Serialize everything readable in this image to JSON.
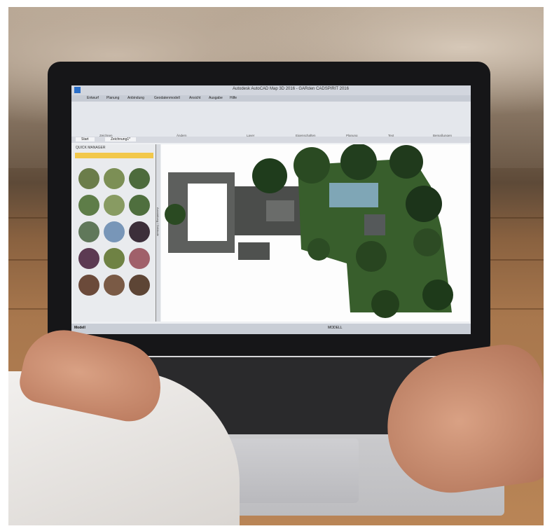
{
  "screen": {
    "title_bar": "Autodesk AutoCAD Map 3D 2016 - GARden CADSPIRIT 2016",
    "ribbon_tabs": [
      "Entwurf",
      "Planung",
      "Anbindung",
      "Geodatenmodell",
      "Ansicht",
      "Ausgabe",
      "Hilfe"
    ],
    "ribbon_groups": [
      "Zeichnen",
      "Ändern",
      "Layer",
      "Eigenschaften",
      "Planung",
      "Text",
      "Bemaßungen"
    ],
    "doc_tabs": [
      "Start",
      "Zeichnung1*"
    ],
    "side_panel_title": "QUICK MANAGER",
    "side_panel_vertical_tab": "Ausstattung / Gebäude",
    "status_model": "Modell",
    "status_model_right": "MODELL"
  }
}
